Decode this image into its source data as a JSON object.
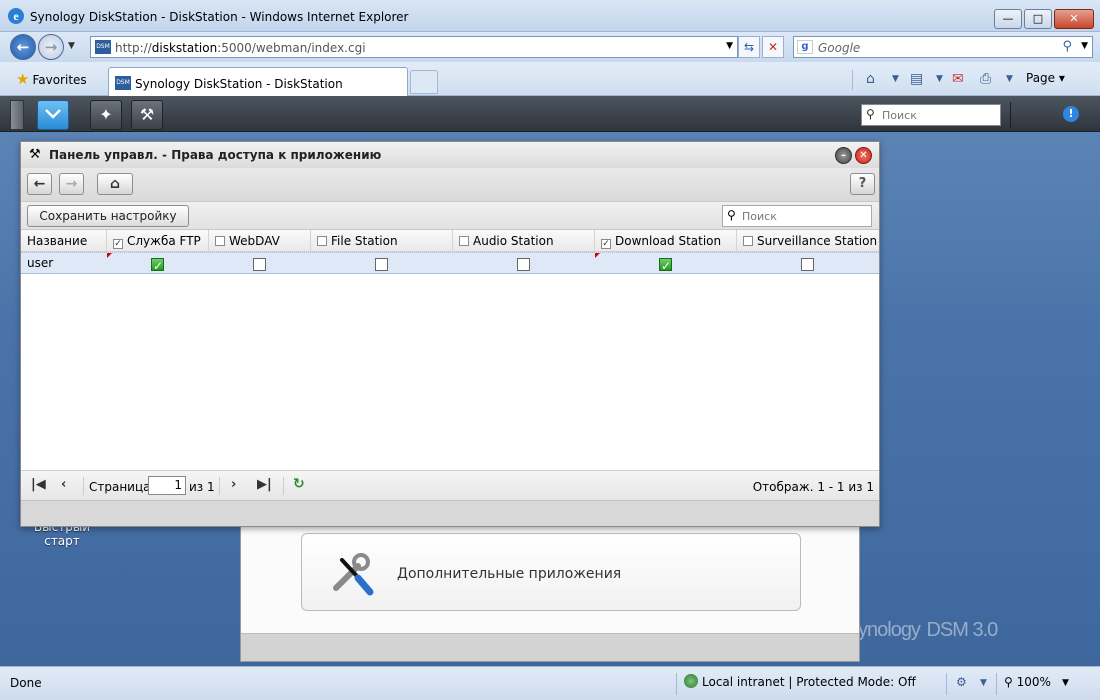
{
  "browser": {
    "window_title": "Synology DiskStation - DiskStation - Windows Internet Explorer",
    "url_prefix": "http://",
    "url_host": "diskstation",
    "url_rest": ":5000/webman/index.cgi",
    "search_placeholder": "Google",
    "favorites_label": "Favorites",
    "tab_title": "Synology DiskStation - DiskStation",
    "page_menu_label": "Page",
    "status": {
      "left_text": "Done",
      "zone_text": "Local intranet | Protected Mode: Off",
      "zoom": "100%"
    }
  },
  "dsm": {
    "taskbar": {
      "search_placeholder": "Поиск"
    },
    "desktop_label_line1": "Быстрый",
    "desktop_label_line2": "старт",
    "brand_text": "ynology",
    "brand_suffix": "DSM 3.0",
    "back_window": {
      "card_label": "Дополнительные приложения"
    },
    "window": {
      "title": "Панель управл. - Права доступа к приложению",
      "save_button": "Сохранить настройку",
      "search_placeholder": "Поиск",
      "columns": [
        {
          "label": "Название",
          "has_checkbox": false,
          "checked": false
        },
        {
          "label": "Служба FTP",
          "has_checkbox": true,
          "checked": true
        },
        {
          "label": "WebDAV",
          "has_checkbox": true,
          "checked": false
        },
        {
          "label": "File Station",
          "has_checkbox": true,
          "checked": false
        },
        {
          "label": "Audio Station",
          "has_checkbox": true,
          "checked": false
        },
        {
          "label": "Download Station",
          "has_checkbox": true,
          "checked": true
        },
        {
          "label": "Surveillance Station",
          "has_checkbox": true,
          "checked": false
        }
      ],
      "rows": [
        {
          "name": "user",
          "permissions": [
            true,
            false,
            false,
            false,
            true,
            false
          ]
        }
      ],
      "pager": {
        "page_label": "Страница",
        "page_value": "1",
        "of_label": "из 1",
        "display_text": "Отображ. 1 - 1 из 1"
      }
    }
  }
}
